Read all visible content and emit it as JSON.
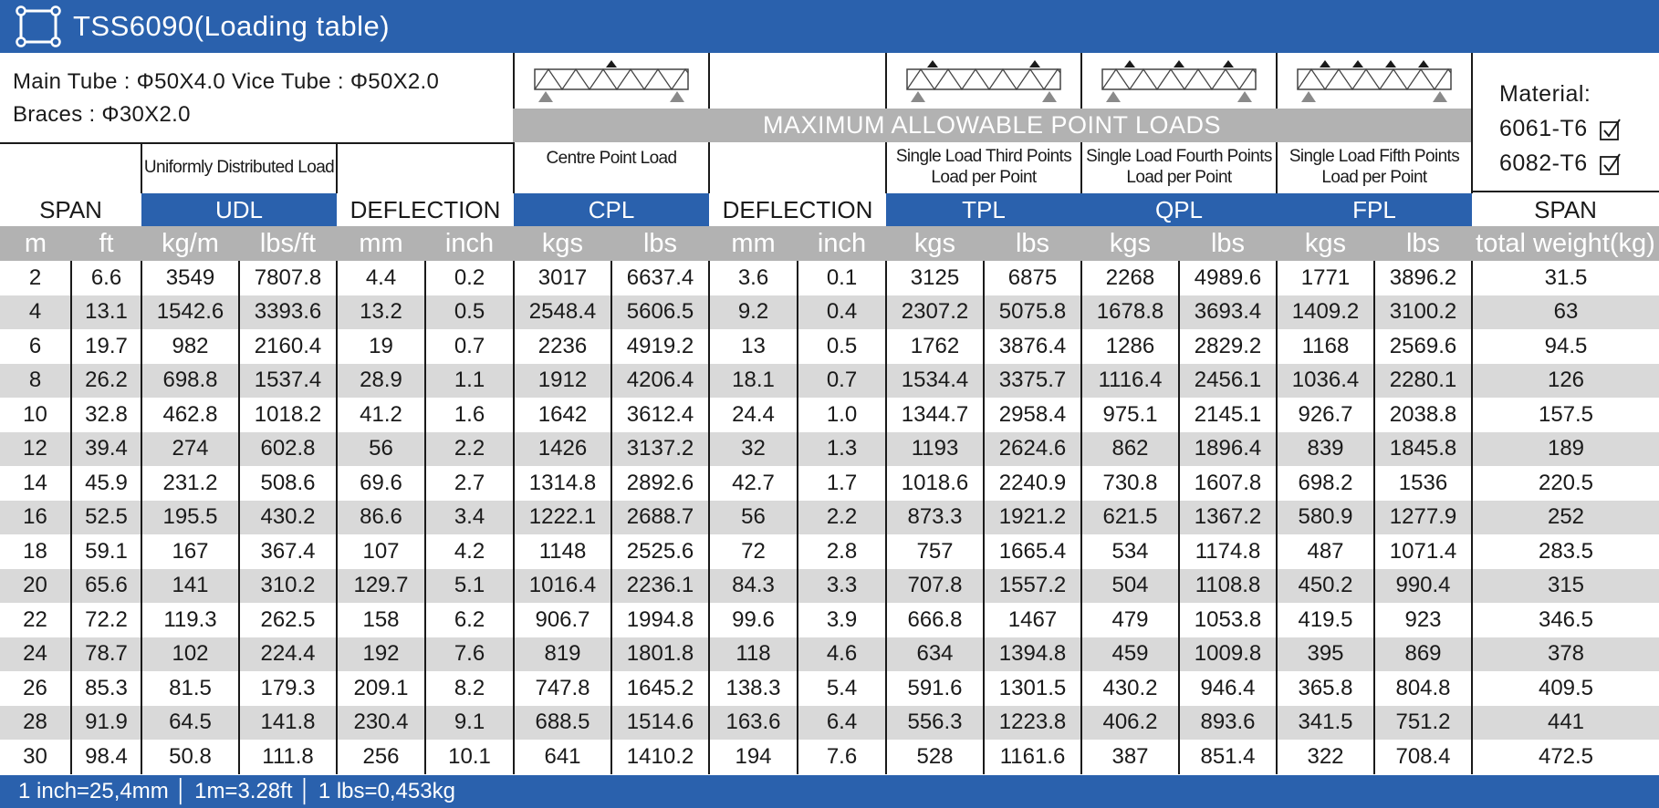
{
  "title": "TSS6090(Loading table)",
  "specs": {
    "line1": "Main Tube : Φ50X4.0   Vice Tube : Φ50X2.0",
    "line2": "Braces : Φ30X2.0"
  },
  "banner": "MAXIMUM ALLOWABLE POINT LOADS",
  "material": {
    "label": "Material:",
    "grades": [
      "6061-T6",
      "6082-T6"
    ]
  },
  "headers": {
    "span": "SPAN",
    "udl_desc": "Uniformly Distributed Load",
    "udl": "UDL",
    "deflection": "DEFLECTION",
    "cpl_desc": "Centre Point Load",
    "cpl": "CPL",
    "tpl_desc": "Single Load Third Points Load per Point",
    "tpl": "TPL",
    "qpl_desc": "Single Load Fourth Points Load per Point",
    "qpl": "QPL",
    "fpl_desc": "Single Load Fifth Points Load per Point",
    "fpl": "FPL"
  },
  "units": [
    "m",
    "ft",
    "kg/m",
    "lbs/ft",
    "mm",
    "inch",
    "kgs",
    "lbs",
    "mm",
    "inch",
    "kgs",
    "lbs",
    "kgs",
    "lbs",
    "kgs",
    "lbs",
    "total weight(kg)"
  ],
  "rows": [
    [
      "2",
      "6.6",
      "3549",
      "7807.8",
      "4.4",
      "0.2",
      "3017",
      "6637.4",
      "3.6",
      "0.1",
      "3125",
      "6875",
      "2268",
      "4989.6",
      "1771",
      "3896.2",
      "31.5"
    ],
    [
      "4",
      "13.1",
      "1542.6",
      "3393.6",
      "13.2",
      "0.5",
      "2548.4",
      "5606.5",
      "9.2",
      "0.4",
      "2307.2",
      "5075.8",
      "1678.8",
      "3693.4",
      "1409.2",
      "3100.2",
      "63"
    ],
    [
      "6",
      "19.7",
      "982",
      "2160.4",
      "19",
      "0.7",
      "2236",
      "4919.2",
      "13",
      "0.5",
      "1762",
      "3876.4",
      "1286",
      "2829.2",
      "1168",
      "2569.6",
      "94.5"
    ],
    [
      "8",
      "26.2",
      "698.8",
      "1537.4",
      "28.9",
      "1.1",
      "1912",
      "4206.4",
      "18.1",
      "0.7",
      "1534.4",
      "3375.7",
      "1116.4",
      "2456.1",
      "1036.4",
      "2280.1",
      "126"
    ],
    [
      "10",
      "32.8",
      "462.8",
      "1018.2",
      "41.2",
      "1.6",
      "1642",
      "3612.4",
      "24.4",
      "1.0",
      "1344.7",
      "2958.4",
      "975.1",
      "2145.1",
      "926.7",
      "2038.8",
      "157.5"
    ],
    [
      "12",
      "39.4",
      "274",
      "602.8",
      "56",
      "2.2",
      "1426",
      "3137.2",
      "32",
      "1.3",
      "1193",
      "2624.6",
      "862",
      "1896.4",
      "839",
      "1845.8",
      "189"
    ],
    [
      "14",
      "45.9",
      "231.2",
      "508.6",
      "69.6",
      "2.7",
      "1314.8",
      "2892.6",
      "42.7",
      "1.7",
      "1018.6",
      "2240.9",
      "730.8",
      "1607.8",
      "698.2",
      "1536",
      "220.5"
    ],
    [
      "16",
      "52.5",
      "195.5",
      "430.2",
      "86.6",
      "3.4",
      "1222.1",
      "2688.7",
      "56",
      "2.2",
      "873.3",
      "1921.2",
      "621.5",
      "1367.2",
      "580.9",
      "1277.9",
      "252"
    ],
    [
      "18",
      "59.1",
      "167",
      "367.4",
      "107",
      "4.2",
      "1148",
      "2525.6",
      "72",
      "2.8",
      "757",
      "1665.4",
      "534",
      "1174.8",
      "487",
      "1071.4",
      "283.5"
    ],
    [
      "20",
      "65.6",
      "141",
      "310.2",
      "129.7",
      "5.1",
      "1016.4",
      "2236.1",
      "84.3",
      "3.3",
      "707.8",
      "1557.2",
      "504",
      "1108.8",
      "450.2",
      "990.4",
      "315"
    ],
    [
      "22",
      "72.2",
      "119.3",
      "262.5",
      "158",
      "6.2",
      "906.7",
      "1994.8",
      "99.6",
      "3.9",
      "666.8",
      "1467",
      "479",
      "1053.8",
      "419.5",
      "923",
      "346.5"
    ],
    [
      "24",
      "78.7",
      "102",
      "224.4",
      "192",
      "7.6",
      "819",
      "1801.8",
      "118",
      "4.6",
      "634",
      "1394.8",
      "459",
      "1009.8",
      "395",
      "869",
      "378"
    ],
    [
      "26",
      "85.3",
      "81.5",
      "179.3",
      "209.1",
      "8.2",
      "747.8",
      "1645.2",
      "138.3",
      "5.4",
      "591.6",
      "1301.5",
      "430.2",
      "946.4",
      "365.8",
      "804.8",
      "409.5"
    ],
    [
      "28",
      "91.9",
      "64.5",
      "141.8",
      "230.4",
      "9.1",
      "688.5",
      "1514.6",
      "163.6",
      "6.4",
      "556.3",
      "1223.8",
      "406.2",
      "893.6",
      "341.5",
      "751.2",
      "441"
    ],
    [
      "30",
      "98.4",
      "50.8",
      "111.8",
      "256",
      "10.1",
      "641",
      "1410.2",
      "194",
      "7.6",
      "528",
      "1161.6",
      "387",
      "851.4",
      "322",
      "708.4",
      "472.5"
    ]
  ],
  "footer": "1 inch=25,4mm │ 1m=3.28ft │ 1 lbs=0,453kg",
  "colors": {
    "brand_blue": "#2a61ad",
    "header_gray": "#b2b2b2",
    "row_stripe": "#d9d9d9"
  },
  "icons": [
    "truss-frame-icon",
    "checkbox-checked-icon"
  ]
}
